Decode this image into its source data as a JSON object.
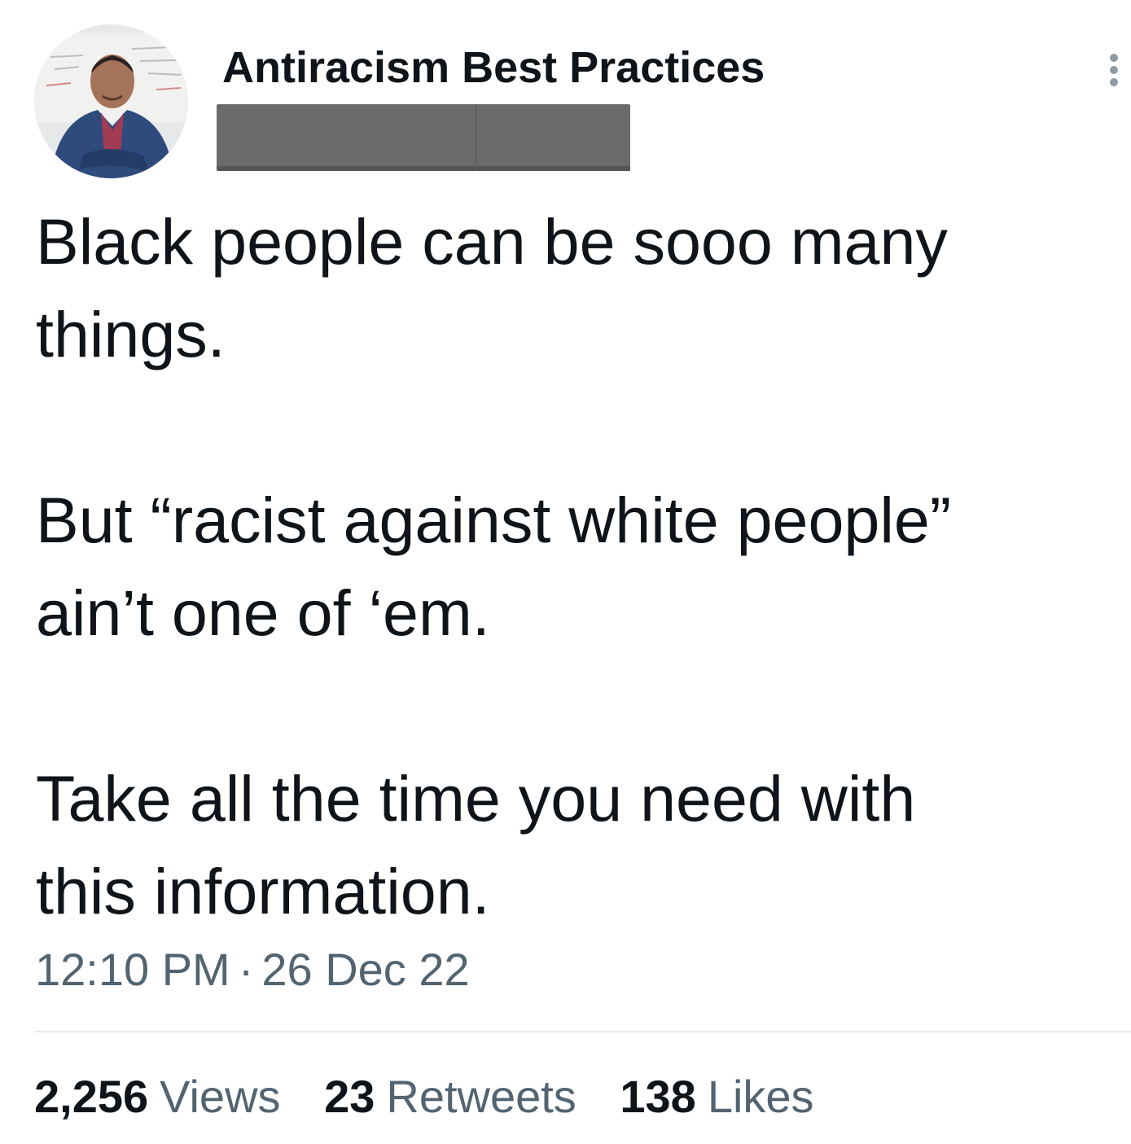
{
  "author": {
    "display_name": "Antiracism Best Practices",
    "avatar_icon": "profile-photo"
  },
  "tweet": {
    "text": "Black people can be sooo many\nthings.\n\nBut “racist against white people”\nain’t one of ‘em.\n\nTake all the time you need with\nthis information.",
    "time": "12:10 PM",
    "separator": "·",
    "date": "26 Dec 22"
  },
  "stats": {
    "views_count": "2,256",
    "views_label": "Views",
    "retweets_count": "23",
    "retweets_label": "Retweets",
    "likes_count": "138",
    "likes_label": "Likes"
  },
  "colors": {
    "text_primary": "#0f1419",
    "text_secondary": "#536471",
    "redaction": "#6a6b6d",
    "divider": "#e7ecef"
  },
  "icons": {
    "more": "more-vertical-icon"
  }
}
